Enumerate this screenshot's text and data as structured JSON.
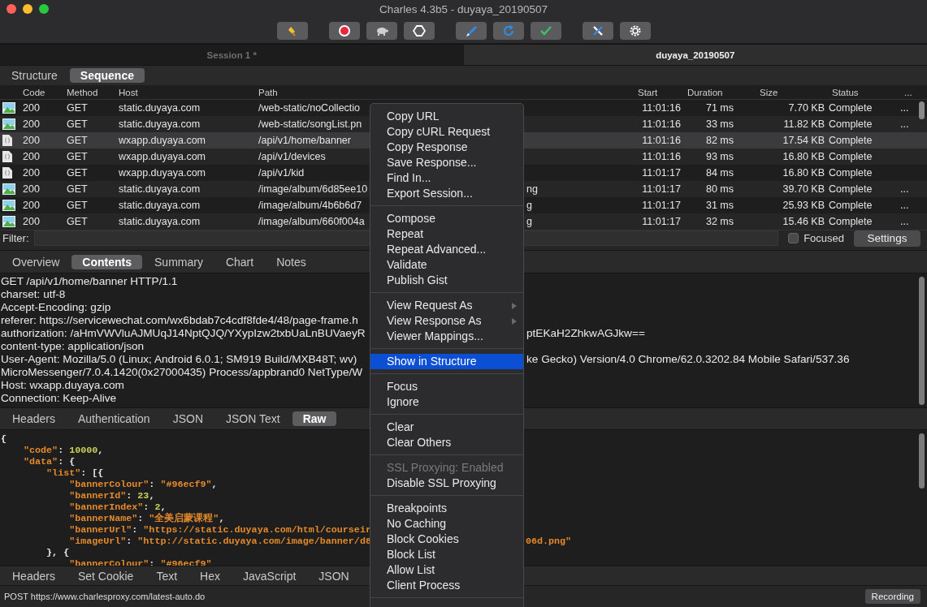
{
  "window": {
    "title": "Charles 4.3b5 - duyaya_20190507"
  },
  "toolbar": [
    [
      {
        "kind": "broom"
      }
    ],
    [
      {
        "kind": "record"
      },
      {
        "kind": "turtle"
      },
      {
        "kind": "stop"
      }
    ],
    [
      {
        "kind": "pen"
      },
      {
        "kind": "refresh"
      },
      {
        "kind": "check"
      }
    ],
    [
      {
        "kind": "tools"
      },
      {
        "kind": "gear"
      }
    ]
  ],
  "session_tabs": [
    {
      "label": "Session 1 *",
      "selected": false
    },
    {
      "label": "duyaya_20190507",
      "selected": true
    }
  ],
  "view_tabs": [
    {
      "label": "Structure",
      "selected": false
    },
    {
      "label": "Sequence",
      "selected": true
    }
  ],
  "table": {
    "columns": [
      "Code",
      "Method",
      "Host",
      "Path",
      "Start",
      "Duration",
      "Size",
      "Status",
      "..."
    ],
    "rows": [
      {
        "kind": "image",
        "code": "200",
        "method": "GET",
        "host": "static.duyaya.com",
        "path": "/web-static/noCollectio",
        "start": "11:01:16",
        "duration": "71 ms",
        "size": "7.70 KB",
        "status": "Complete",
        "more": "...",
        "selected": false
      },
      {
        "kind": "image",
        "code": "200",
        "method": "GET",
        "host": "static.duyaya.com",
        "path": "/web-static/songList.pn",
        "start": "11:01:16",
        "duration": "33 ms",
        "size": "11.82 KB",
        "status": "Complete",
        "more": "...",
        "selected": false
      },
      {
        "kind": "json",
        "code": "200",
        "method": "GET",
        "host": "wxapp.duyaya.com",
        "path": "/api/v1/home/banner",
        "start": "11:01:16",
        "duration": "82 ms",
        "size": "17.54 KB",
        "status": "Complete",
        "selected": true
      },
      {
        "kind": "json",
        "code": "200",
        "method": "GET",
        "host": "wxapp.duyaya.com",
        "path": "/api/v1/devices",
        "start": "11:01:16",
        "duration": "93 ms",
        "size": "16.80 KB",
        "status": "Complete",
        "selected": false
      },
      {
        "kind": "json",
        "code": "200",
        "method": "GET",
        "host": "wxapp.duyaya.com",
        "path": "/api/v1/kid",
        "start": "11:01:17",
        "duration": "84 ms",
        "size": "16.80 KB",
        "status": "Complete",
        "selected": false
      },
      {
        "kind": "image",
        "code": "200",
        "method": "GET",
        "host": "static.duyaya.com",
        "path": "/image/album/6d85ee10",
        "path_tail": "ng",
        "start": "11:01:17",
        "duration": "80 ms",
        "size": "39.70 KB",
        "status": "Complete",
        "more": "...",
        "selected": false
      },
      {
        "kind": "image",
        "code": "200",
        "method": "GET",
        "host": "static.duyaya.com",
        "path": "/image/album/4b6b6d7",
        "path_tail": "g",
        "start": "11:01:17",
        "duration": "31 ms",
        "size": "25.93 KB",
        "status": "Complete",
        "more": "...",
        "selected": false
      },
      {
        "kind": "image",
        "code": "200",
        "method": "GET",
        "host": "static.duyaya.com",
        "path": "/image/album/660f004a",
        "path_tail": "g",
        "start": "11:01:17",
        "duration": "32 ms",
        "size": "15.46 KB",
        "status": "Complete",
        "more": "...",
        "selected": false
      }
    ]
  },
  "filter": {
    "label": "Filter:",
    "focused": {
      "label": "Focused",
      "checked": false
    },
    "settings": "Settings"
  },
  "detail_tabs": [
    {
      "label": "Overview",
      "selected": false
    },
    {
      "label": "Contents",
      "selected": true
    },
    {
      "label": "Summary",
      "selected": false
    },
    {
      "label": "Chart",
      "selected": false
    },
    {
      "label": "Notes",
      "selected": false
    }
  ],
  "request_lines": [
    {
      "text": "GET /api/v1/home/banner HTTP/1.1"
    },
    {
      "text": "charset: utf-8"
    },
    {
      "text": "Accept-Encoding: gzip"
    },
    {
      "text": "referer: https://servicewechat.com/wx6bdab7c4cdf8fde4/48/page-frame.h"
    },
    {
      "text": "authorization: /aHmVWVluAJMUqJ14NptQJQ/YXypIzw2txbUaLnBUVaeyR",
      "tail": "ptEKaH2ZhkwAGJkw=="
    },
    {
      "text": "content-type: application/json"
    },
    {
      "text": "User-Agent: Mozilla/5.0 (Linux; Android 6.0.1; SM919 Build/MXB48T; wv)",
      "tail": "ke Gecko) Version/4.0 Chrome/62.0.3202.84 Mobile Safari/537.36"
    },
    {
      "text": "MicroMessenger/7.0.4.1420(0x27000435) Process/appbrand0 NetType/W"
    },
    {
      "text": "Host: wxapp.duyaya.com"
    },
    {
      "text": "Connection: Keep-Alive"
    }
  ],
  "body_tabs": [
    {
      "label": "Headers",
      "selected": false
    },
    {
      "label": "Authentication",
      "selected": false
    },
    {
      "label": "JSON",
      "selected": false
    },
    {
      "label": "JSON Text",
      "selected": false
    },
    {
      "label": "Raw",
      "selected": true
    }
  ],
  "body_lines": [
    {
      "segments": [
        {
          "kind": "plain",
          "text": "{"
        }
      ]
    },
    {
      "segments": [
        {
          "kind": "key",
          "text": "    \"code\""
        },
        {
          "kind": "plain",
          "text": ": "
        },
        {
          "kind": "number",
          "text": "10000"
        },
        {
          "kind": "plain",
          "text": ","
        }
      ]
    },
    {
      "segments": [
        {
          "kind": "key",
          "text": "    \"data\""
        },
        {
          "kind": "plain",
          "text": ": {"
        }
      ]
    },
    {
      "segments": [
        {
          "kind": "key",
          "text": "        \"list\""
        },
        {
          "kind": "plain",
          "text": ": [{"
        }
      ]
    },
    {
      "segments": [
        {
          "kind": "key",
          "text": "            \"bannerColour\""
        },
        {
          "kind": "plain",
          "text": ": "
        },
        {
          "kind": "string",
          "text": "\"#96ecf9\""
        },
        {
          "kind": "plain",
          "text": ","
        }
      ]
    },
    {
      "segments": [
        {
          "kind": "key",
          "text": "            \"bannerId\""
        },
        {
          "kind": "plain",
          "text": ": "
        },
        {
          "kind": "number",
          "text": "23"
        },
        {
          "kind": "plain",
          "text": ","
        }
      ]
    },
    {
      "segments": [
        {
          "kind": "key",
          "text": "            \"bannerIndex\""
        },
        {
          "kind": "plain",
          "text": ": "
        },
        {
          "kind": "number",
          "text": "2"
        },
        {
          "kind": "plain",
          "text": ","
        }
      ]
    },
    {
      "segments": [
        {
          "kind": "key",
          "text": "            \"bannerName\""
        },
        {
          "kind": "plain",
          "text": ": "
        },
        {
          "kind": "string",
          "text": "\"全美启蒙课程\""
        },
        {
          "kind": "plain",
          "text": ","
        }
      ]
    },
    {
      "segments": [
        {
          "kind": "key",
          "text": "            \"bannerUrl\""
        },
        {
          "kind": "plain",
          "text": ": "
        },
        {
          "kind": "string",
          "text": "\"https://static.duyaya.com/html/courseir"
        }
      ]
    },
    {
      "segments": [
        {
          "kind": "key",
          "text": "            \"imageUrl\""
        },
        {
          "kind": "plain",
          "text": ": "
        },
        {
          "kind": "string",
          "text": "\"http://static.duyaya.com/image/banner/d8"
        }
      ],
      "tail": [
        {
          "kind": "string",
          "text": "06d.png\""
        }
      ]
    },
    {
      "segments": [
        {
          "kind": "plain",
          "text": "        }, {"
        }
      ]
    },
    {
      "segments": [
        {
          "kind": "key",
          "text": "            \"bannerColour\""
        },
        {
          "kind": "plain",
          "text": ": "
        },
        {
          "kind": "string",
          "text": "\"#96ecf9\""
        }
      ]
    }
  ],
  "bottom_tabs": [
    {
      "label": "Headers",
      "selected": false
    },
    {
      "label": "Set Cookie",
      "selected": false
    },
    {
      "label": "Text",
      "selected": false
    },
    {
      "label": "Hex",
      "selected": false
    },
    {
      "label": "JavaScript",
      "selected": false
    },
    {
      "label": "JSON",
      "selected": false
    }
  ],
  "status_bar": {
    "text": "POST https://www.charlesproxy.com/latest-auto.do",
    "recording": "Recording"
  },
  "context_menu": [
    [
      {
        "label": "Copy URL"
      },
      {
        "label": "Copy cURL Request"
      },
      {
        "label": "Copy Response"
      },
      {
        "label": "Save Response..."
      },
      {
        "label": "Find In..."
      },
      {
        "label": "Export Session..."
      }
    ],
    [
      {
        "label": "Compose"
      },
      {
        "label": "Repeat"
      },
      {
        "label": "Repeat Advanced..."
      },
      {
        "label": "Validate"
      },
      {
        "label": "Publish Gist"
      }
    ],
    [
      {
        "label": "View Request As",
        "submenu": true
      },
      {
        "label": "View Response As",
        "submenu": true
      },
      {
        "label": "Viewer Mappings..."
      }
    ],
    [
      {
        "label": "Show in Structure",
        "selected": true
      }
    ],
    [
      {
        "label": "Focus"
      },
      {
        "label": "Ignore"
      }
    ],
    [
      {
        "label": "Clear"
      },
      {
        "label": "Clear Others"
      }
    ],
    [
      {
        "label": "SSL Proxying: Enabled",
        "disabled": true
      },
      {
        "label": "Disable SSL Proxying"
      }
    ],
    [
      {
        "label": "Breakpoints"
      },
      {
        "label": "No Caching"
      },
      {
        "label": "Block Cookies"
      },
      {
        "label": "Block List"
      },
      {
        "label": "Allow List"
      },
      {
        "label": "Client Process"
      }
    ]
  ]
}
